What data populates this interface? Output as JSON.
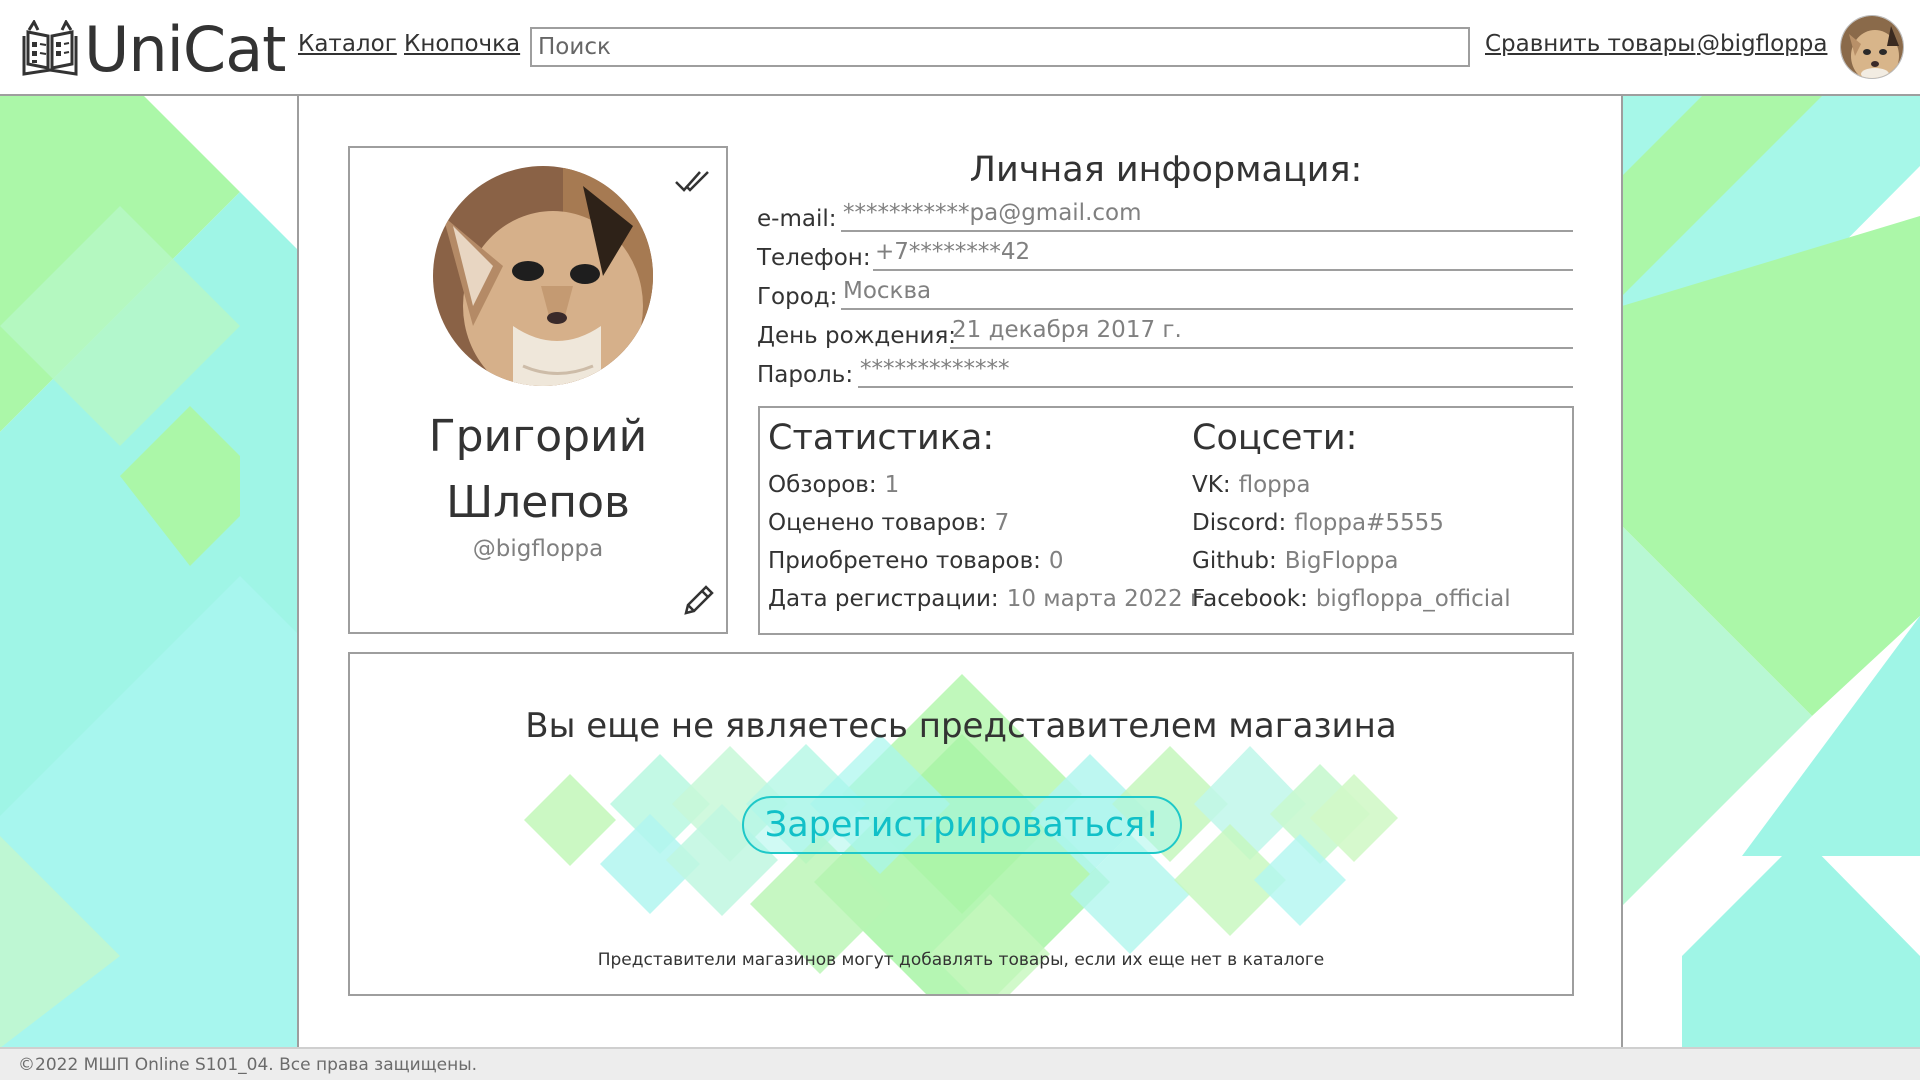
{
  "header": {
    "logo_text": "UniCat",
    "nav": [
      "Каталог",
      "Кнопочка"
    ],
    "search_placeholder": "Поиск",
    "compare_link": "Сравнить товары",
    "user_link": "@bigfloppa"
  },
  "profile": {
    "first_name": "Григорий",
    "last_name": "Шлепов",
    "handle": "@bigfloppa"
  },
  "personal_info": {
    "title": "Личная информация:",
    "rows": [
      {
        "label": "e-mail:",
        "value": "***********pa@gmail.com"
      },
      {
        "label": "Телефон:",
        "value": "+7********42"
      },
      {
        "label": "Город:",
        "value": "Москва"
      },
      {
        "label": "День рождения:",
        "value": "21 декабря 2017 г."
      },
      {
        "label": "Пароль:",
        "value": "*************"
      }
    ]
  },
  "statistics": {
    "title": "Статистика:",
    "rows": [
      {
        "label": "Обзоров:",
        "value": "1"
      },
      {
        "label": "Оценено товаров:",
        "value": "7"
      },
      {
        "label": "Приобретено товаров:",
        "value": "0"
      },
      {
        "label": "Дата регистрации:",
        "value": "10 марта 2022 г."
      }
    ]
  },
  "socials": {
    "title": "Соцсети:",
    "rows": [
      {
        "label": "VK:",
        "value": "floppa"
      },
      {
        "label": "Discord:",
        "value": "floppa#5555"
      },
      {
        "label": "Github:",
        "value": "BigFloppa"
      },
      {
        "label": "Facebook:",
        "value": "bigfloppa_official"
      }
    ]
  },
  "shop": {
    "message": "Вы еще не являетесь представителем магазина",
    "button": "Зарегистрироваться!",
    "note": "Представители магазинов могут добавлять товары, если их еще нет в каталоге"
  },
  "footer": {
    "copyright": "©2022 МШП Online S101_04. Все права защищены."
  },
  "colors": {
    "accent": "#1ec8c8",
    "deco_green": "#a8f5a0",
    "deco_cyan": "#a0f5ea",
    "border": "#9e9e9e"
  },
  "icons": [
    "book-logo-icon",
    "check-icon",
    "pencil-icon",
    "avatar-cat"
  ]
}
